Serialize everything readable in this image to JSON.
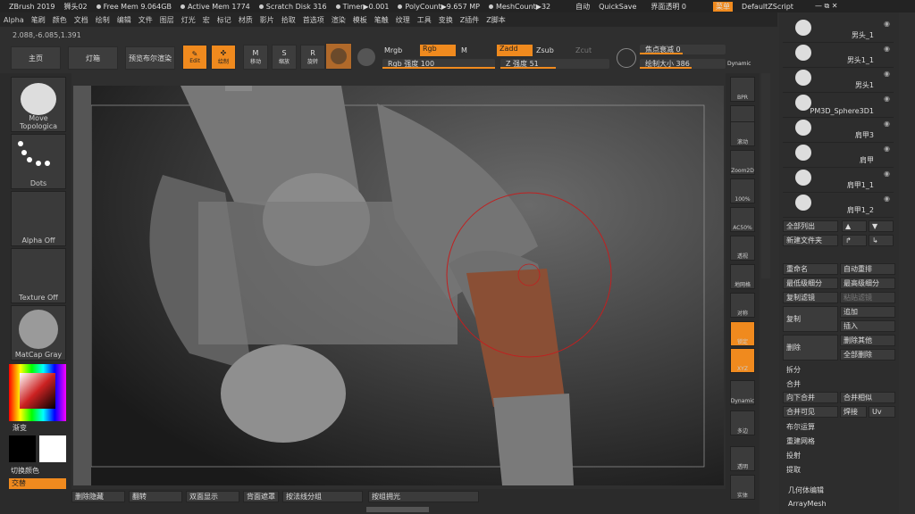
{
  "title_bar": {
    "app": "ZBrush 2019",
    "model": "狮头02",
    "free_mem": "Free Mem 9.064GB",
    "active_mem": "Active Mem 1774",
    "scratch": "Scratch Disk 316",
    "timer": "Timer▶0.001",
    "poly": "PolyCount▶9.657 MP",
    "mesh": "MeshCount▶32",
    "auto": "自动",
    "quicksave": "QuickSave",
    "transparency": "界面透明 0",
    "menu_label": "菜单",
    "script": "DefaultZScript"
  },
  "menu": [
    "Alpha",
    "笔刷",
    "颜色",
    "文档",
    "绘制",
    "编辑",
    "文件",
    "图层",
    "灯光",
    "宏",
    "标记",
    "材质",
    "影片",
    "拾取",
    "首选项",
    "渲染",
    "模板",
    "笔触",
    "纹理",
    "工具",
    "变换",
    "Z插件",
    "Z脚本"
  ],
  "coords": "2.088,-6.085,1.391",
  "toolbar": {
    "home": "主页",
    "lightbox": "灯箱",
    "preview": "预览布尔渲染",
    "edit": "Edit",
    "draw": "绘制",
    "move": "移动",
    "scale": "缩放",
    "rotate": "旋转",
    "mrgb": "Mrgb",
    "rgb": "Rgb",
    "m": "M",
    "zadd": "Zadd",
    "zsub": "Zsub",
    "zcut": "Zcut",
    "rgb_intensity": "Rgb 强度 100",
    "z_intensity": "Z 强度 51",
    "focal": "焦点衰减 0",
    "draw_size": "绘制大小 386",
    "dynamic": "Dynamic"
  },
  "left": {
    "brush": "Move Topologica",
    "stroke": "Dots",
    "alpha": "Alpha Off",
    "texture": "Texture Off",
    "material": "MatCap Gray",
    "gradient": "渐变",
    "switch": "切换颜色",
    "alternate": "交替"
  },
  "right_tools": [
    "BPR",
    "子像素",
    "滚动",
    "Zoom2D",
    "100%",
    "AC50%",
    "透视",
    "地网格",
    "对称",
    "锁定",
    "XYZ",
    "Dynamic",
    "多边",
    "透明",
    "实体"
  ],
  "subtools": [
    {
      "name": "男头_1"
    },
    {
      "name": "男头1_1"
    },
    {
      "name": "男头1"
    },
    {
      "name": "PM3D_Sphere3D1"
    },
    {
      "name": "肩甲3"
    },
    {
      "name": "肩甲"
    },
    {
      "name": "肩甲1_1"
    },
    {
      "name": "肩甲1_2"
    }
  ],
  "subtool_buttons": {
    "list_all": "全部列出",
    "new_folder": "新建文件夹",
    "rename": "重命名",
    "auto_reorder": "自动重排",
    "lowest_sub": "最低级细分",
    "highest_sub": "最高级细分",
    "copy_sub": "复制滤镜",
    "paste_sub": "粘贴滤镜",
    "duplicate": "复制",
    "append": "追加",
    "insert": "插入",
    "delete": "删除",
    "delete_other": "删除其他",
    "delete_all": "全部删除",
    "split": "拆分",
    "merge": "合并",
    "merge_down": "向下合并",
    "merge_similar": "合并相似",
    "merge_visible": "合并可见",
    "weld": "焊接",
    "uv": "Uv",
    "boolean": "布尔运算",
    "remesh": "重建网格",
    "project": "投射",
    "extract": "提取",
    "geometry": "几何体编辑",
    "arraymesh": "ArrayMesh"
  },
  "bottom": {
    "del_hidden": "删除隐藏",
    "flip": "翻转",
    "double": "双面显示",
    "backface": "背面遮罩",
    "polygroup": "按法线分组",
    "by_group": "按组拥光"
  }
}
